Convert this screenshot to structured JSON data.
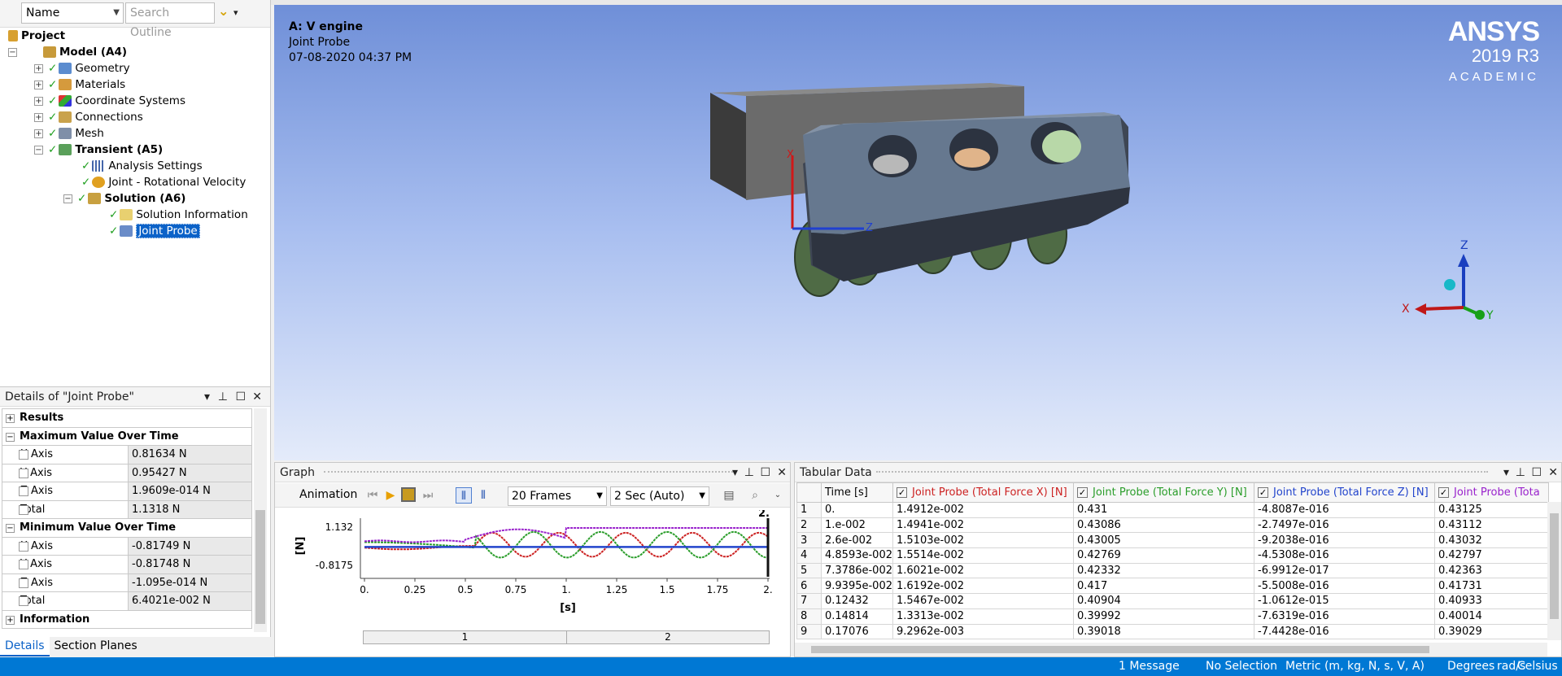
{
  "tree_toolbar": {
    "name_combo": "Name",
    "search_placeholder": "Search Outline"
  },
  "tree": {
    "project": "Project",
    "model": "Model (A4)",
    "geometry": "Geometry",
    "materials": "Materials",
    "coordinate_systems": "Coordinate Systems",
    "connections": "Connections",
    "mesh": "Mesh",
    "transient": "Transient (A5)",
    "analysis_settings": "Analysis Settings",
    "joint_rot_velocity": "Joint - Rotational Velocity",
    "solution": "Solution (A6)",
    "solution_information": "Solution Information",
    "joint_probe": "Joint Probe"
  },
  "details": {
    "title": "Details of \"Joint Probe\"",
    "groups": {
      "results": "Results",
      "max": "Maximum Value Over Time",
      "min": "Minimum Value Over Time",
      "information": "Information"
    },
    "max_rows": [
      {
        "label": "X Axis",
        "value": "0.81634 N"
      },
      {
        "label": "Y Axis",
        "value": "0.95427 N"
      },
      {
        "label": "Z Axis",
        "value": "1.9609e-014 N"
      },
      {
        "label": "Total",
        "value": "1.1318 N"
      }
    ],
    "min_rows": [
      {
        "label": "X Axis",
        "value": "-0.81749 N"
      },
      {
        "label": "Y Axis",
        "value": "-0.81748 N"
      },
      {
        "label": "Z Axis",
        "value": "-1.095e-014 N"
      },
      {
        "label": "Total",
        "value": "6.4021e-002 N"
      }
    ],
    "tabs": {
      "details": "Details",
      "section_planes": "Section Planes"
    }
  },
  "viewport": {
    "title": "A: V engine",
    "subtitle": "Joint Probe",
    "timestamp": "07-08-2020 04:37 PM",
    "logo_name": "ANSYS",
    "logo_version": "2019 R3",
    "logo_edition": "ACADEMIC",
    "triad": {
      "z": "Z",
      "x": "X",
      "y": "Y"
    }
  },
  "graph": {
    "title": "Graph",
    "animation_label": "Animation",
    "frames": "20 Frames",
    "duration": "2 Sec (Auto)",
    "frame_segments": [
      "1",
      "2"
    ]
  },
  "chart_data": {
    "type": "line",
    "ylabel": "[N]",
    "xlabel": "[s]",
    "x_ticks": [
      "0.",
      "0.25",
      "0.5",
      "0.75",
      "1.",
      "1.25",
      "1.5",
      "1.75",
      "2."
    ],
    "y_ticks": [
      "1.132",
      "-0.8175"
    ],
    "xlim": [
      0,
      2
    ],
    "ylim": [
      -0.8175,
      1.132
    ],
    "current_time_label": "2.",
    "series": [
      {
        "color": "#cc2222"
      },
      {
        "color": "#2a9d2a"
      },
      {
        "color": "#2244cc"
      },
      {
        "color": "#9922cc"
      }
    ]
  },
  "tabular": {
    "title": "Tabular Data",
    "headers": {
      "time": "Time [s]",
      "fx": "Joint Probe (Total Force X) [N]",
      "fy": "Joint Probe (Total Force Y) [N]",
      "fz": "Joint Probe (Total Force Z) [N]",
      "ft": "Joint Probe (Tota"
    },
    "header_colors": {
      "fx": "#cc2222",
      "fy": "#2a9d2a",
      "fz": "#2244cc",
      "ft": "#9922cc"
    },
    "rows": [
      [
        "1",
        "0.",
        "1.4912e-002",
        "0.431",
        "-4.8087e-016",
        "0.43125"
      ],
      [
        "2",
        "1.e-002",
        "1.4941e-002",
        "0.43086",
        "-2.7497e-016",
        "0.43112"
      ],
      [
        "3",
        "2.6e-002",
        "1.5103e-002",
        "0.43005",
        "-9.2038e-016",
        "0.43032"
      ],
      [
        "4",
        "4.8593e-002",
        "1.5514e-002",
        "0.42769",
        "-4.5308e-016",
        "0.42797"
      ],
      [
        "5",
        "7.3786e-002",
        "1.6021e-002",
        "0.42332",
        "-6.9912e-017",
        "0.42363"
      ],
      [
        "6",
        "9.9395e-002",
        "1.6192e-002",
        "0.417",
        "-5.5008e-016",
        "0.41731"
      ],
      [
        "7",
        "0.12432",
        "1.5467e-002",
        "0.40904",
        "-1.0612e-015",
        "0.40933"
      ],
      [
        "8",
        "0.14814",
        "1.3313e-002",
        "0.39992",
        "-7.6319e-016",
        "0.40014"
      ],
      [
        "9",
        "0.17076",
        "9.2962e-003",
        "0.39018",
        "-7.4428e-016",
        "0.39029"
      ]
    ]
  },
  "status": {
    "messages": "1 Message",
    "selection": "No Selection",
    "units": "Metric (m, kg, N, s, V, A)",
    "angle": "Degrees",
    "rate": "rad/s",
    "temp": "Celsius"
  }
}
